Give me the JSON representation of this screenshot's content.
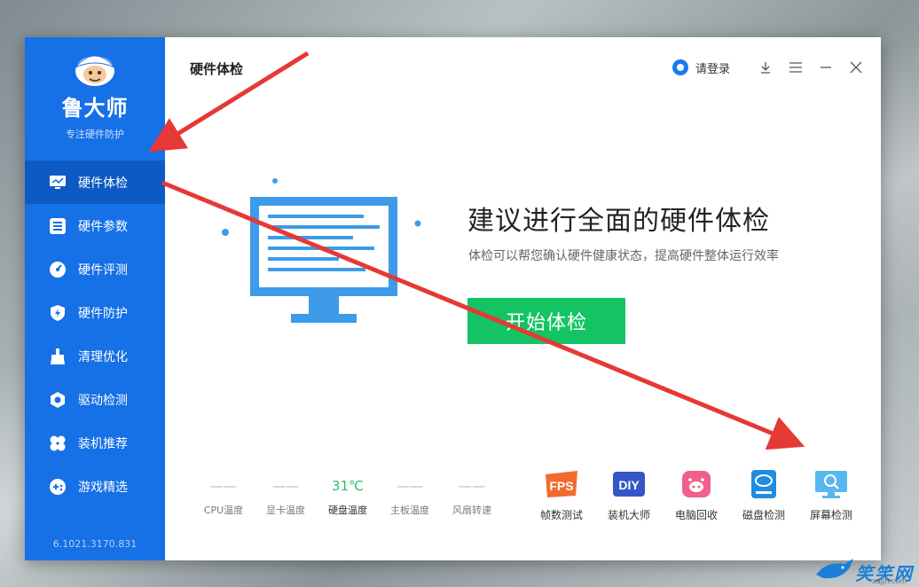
{
  "app": {
    "name": "鲁大师",
    "slogan": "专注硬件防护",
    "version": "6.1021.3170.831"
  },
  "sidebar": {
    "items": [
      {
        "label": "硬件体检",
        "icon": "monitor-check-icon",
        "active": true
      },
      {
        "label": "硬件参数",
        "icon": "parameters-icon",
        "active": false
      },
      {
        "label": "硬件评测",
        "icon": "speedometer-icon",
        "active": false
      },
      {
        "label": "硬件防护",
        "icon": "shield-bolt-icon",
        "active": false
      },
      {
        "label": "清理优化",
        "icon": "broom-icon",
        "active": false
      },
      {
        "label": "驱动检测",
        "icon": "gear-hexagon-icon",
        "active": false
      },
      {
        "label": "装机推荐",
        "icon": "fan-icon",
        "active": false
      },
      {
        "label": "游戏精选",
        "icon": "gamepad-icon",
        "active": false
      }
    ]
  },
  "header": {
    "title": "硬件体检",
    "login_label": "请登录"
  },
  "hero": {
    "title": "建议进行全面的硬件体检",
    "subtitle": "体检可以帮您确认硬件健康状态，提高硬件整体运行效率",
    "start_button": "开始体检"
  },
  "temperatures": [
    {
      "value": "——",
      "label": "CPU温度"
    },
    {
      "value": "——",
      "label": "显卡温度"
    },
    {
      "value": "31℃",
      "label": "硬盘温度"
    },
    {
      "value": "——",
      "label": "主板温度"
    },
    {
      "value": "——",
      "label": "风扇转速"
    }
  ],
  "tools": [
    {
      "label": "帧数测试",
      "icon": "fps-icon"
    },
    {
      "label": "装机大师",
      "icon": "diy-icon"
    },
    {
      "label": "电脑回收",
      "icon": "pig-icon"
    },
    {
      "label": "磁盘检测",
      "icon": "disk-icon"
    },
    {
      "label": "屏幕检测",
      "icon": "screen-magnifier-icon"
    }
  ],
  "watermark": {
    "text": "笑笑网",
    "url": "xajjn.com"
  },
  "colors": {
    "sidebar_bg": "#1670e6",
    "sidebar_active": "#0d5ac4",
    "start_button": "#14c464",
    "arrow": "#e53935"
  }
}
